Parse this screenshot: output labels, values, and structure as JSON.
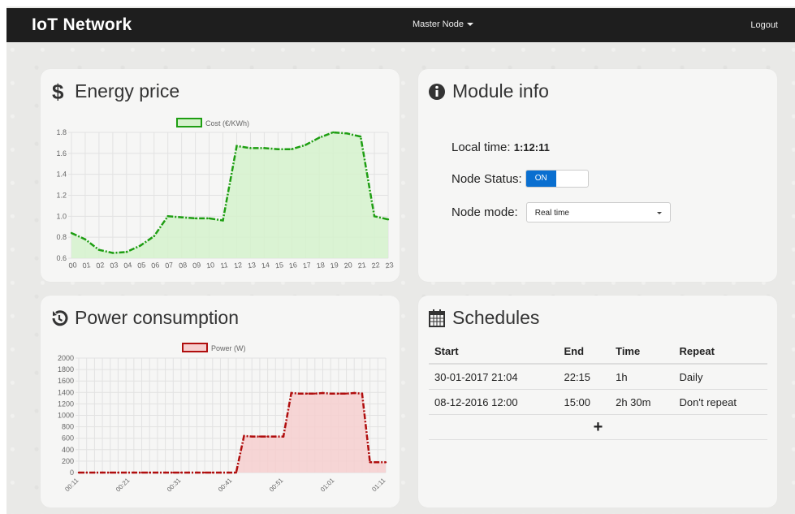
{
  "navbar": {
    "brand": "IoT Network",
    "node_menu": "Master Node",
    "logout": "Logout"
  },
  "energy_card": {
    "title": "Energy price",
    "icon": "dollar-icon",
    "chart_data": {
      "type": "line",
      "legend": "Cost (€/KWh)",
      "categories": [
        "00",
        "01",
        "02",
        "03",
        "04",
        "05",
        "06",
        "07",
        "08",
        "09",
        "10",
        "11",
        "12",
        "13",
        "14",
        "15",
        "16",
        "17",
        "18",
        "19",
        "20",
        "21",
        "22",
        "23"
      ],
      "values": [
        0.84,
        0.78,
        0.68,
        0.65,
        0.66,
        0.72,
        0.81,
        1.0,
        0.99,
        0.98,
        0.98,
        0.96,
        1.67,
        1.65,
        1.65,
        1.64,
        1.64,
        1.68,
        1.75,
        1.8,
        1.79,
        1.76,
        1.0,
        0.97
      ],
      "ylim": [
        0.6,
        1.8
      ],
      "yticks": [
        "1.8",
        "1.6",
        "1.4",
        "1.2",
        "1.0",
        "0.8",
        "0.6"
      ],
      "color": "#1e9e12",
      "fill": "#d5f2cc",
      "grid": true,
      "legend_position": "top"
    }
  },
  "module_card": {
    "title": "Module info",
    "icon": "info-icon",
    "local_time_label": "Local time:",
    "local_time_value": "1:12:11",
    "status_label": "Node Status:",
    "status_toggle": "ON",
    "mode_label": "Node mode:",
    "mode_value": "Real time"
  },
  "power_card": {
    "title": "Power consumption",
    "icon": "history-icon",
    "chart_data": {
      "type": "line",
      "legend": "Power (W)",
      "x_labels": [
        "00:11",
        "00:21",
        "00:31",
        "00:41",
        "00:51",
        "01:01",
        "01:11"
      ],
      "values": [
        0,
        0,
        0,
        0,
        0,
        0,
        0,
        0,
        0,
        0,
        0,
        0,
        0,
        0,
        0,
        0,
        0,
        0,
        0,
        0,
        0,
        640,
        630,
        630,
        630,
        630,
        630,
        1390,
        1380,
        1380,
        1380,
        1390,
        1380,
        1380,
        1380,
        1390,
        1380,
        180,
        180,
        180
      ],
      "ylim": [
        0,
        2000
      ],
      "yticks": [
        "2000",
        "1800",
        "1600",
        "1400",
        "1200",
        "1000",
        "800",
        "600",
        "400",
        "200",
        "0"
      ],
      "color": "#b00e0e",
      "fill": "#f6cfcf",
      "grid": true,
      "legend_position": "top"
    }
  },
  "schedules_card": {
    "title": "Schedules",
    "icon": "calendar-icon",
    "headers": {
      "start": "Start",
      "end": "End",
      "time": "Time",
      "repeat": "Repeat"
    },
    "rows": [
      {
        "start": "30-01-2017 21:04",
        "end": "22:15",
        "time": "1h",
        "repeat": "Daily"
      },
      {
        "start": "08-12-2016 12:00",
        "end": "15:00",
        "time": "2h 30m",
        "repeat": "Don't repeat"
      }
    ],
    "add_label": "+"
  }
}
